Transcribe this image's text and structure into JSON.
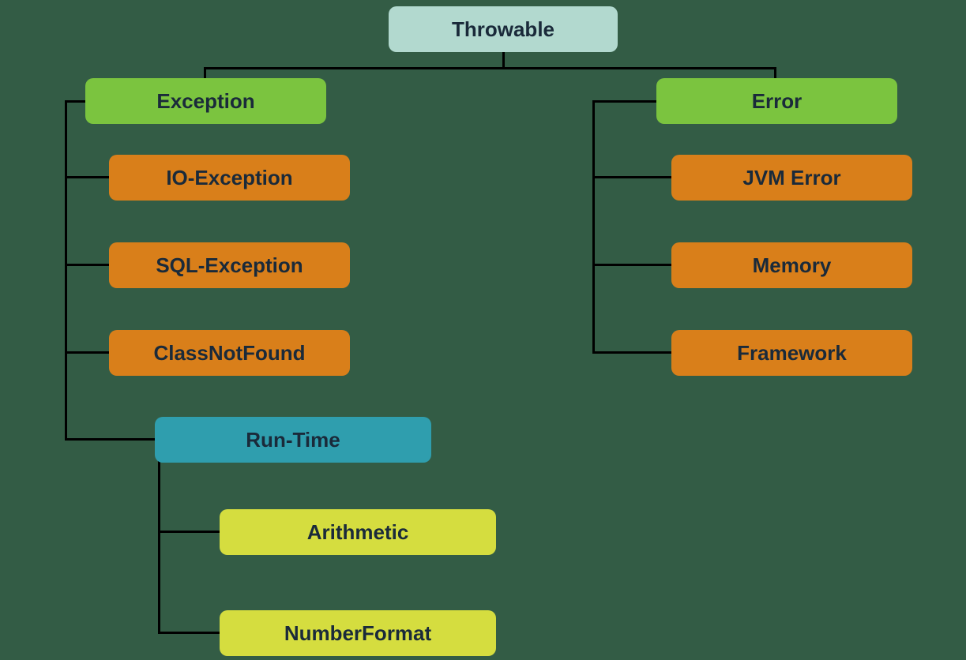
{
  "root": {
    "label": "Throwable"
  },
  "exception": {
    "label": "Exception",
    "children": [
      {
        "label": "IO-Exception"
      },
      {
        "label": "SQL-Exception"
      },
      {
        "label": "ClassNotFound"
      }
    ],
    "runtime": {
      "label": "Run-Time",
      "children": [
        {
          "label": "Arithmetic"
        },
        {
          "label": "NumberFormat"
        }
      ]
    }
  },
  "error": {
    "label": "Error",
    "children": [
      {
        "label": "JVM Error"
      },
      {
        "label": "Memory"
      },
      {
        "label": "Framework"
      }
    ]
  }
}
